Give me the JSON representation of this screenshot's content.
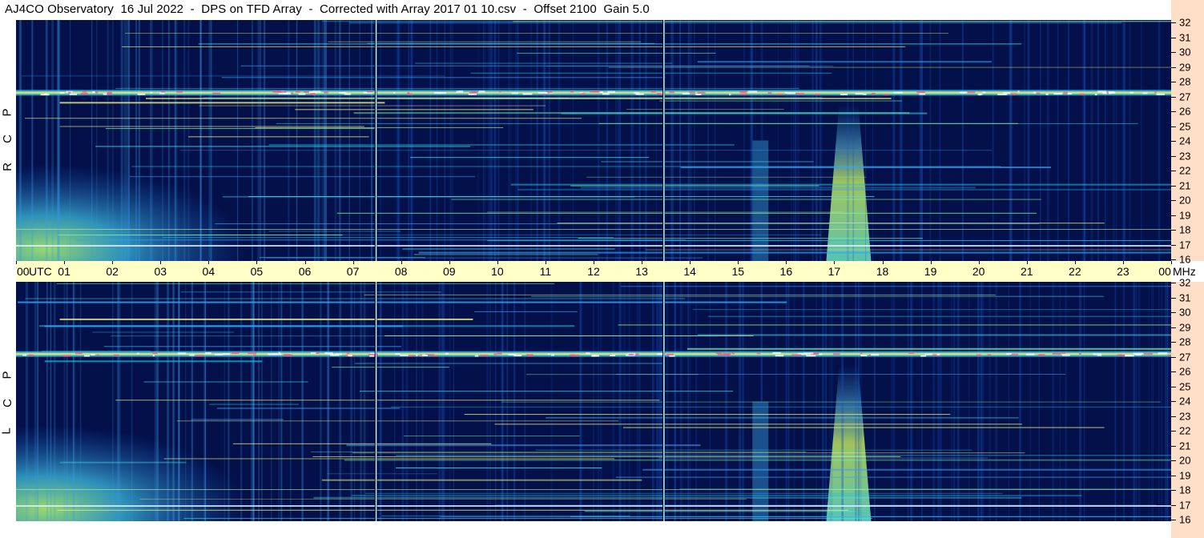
{
  "title": "AJ4CO Observatory  16 Jul 2022  -  DPS on TFD Array  -  Corrected with Array 2017 01 10.csv  -  Offset 2100  Gain 5.0",
  "panels": [
    {
      "id": "top",
      "polarization": [
        "R",
        "C",
        "P"
      ]
    },
    {
      "id": "bottom",
      "polarization": [
        "L",
        "C",
        "P"
      ]
    }
  ],
  "time_axis": {
    "labels": [
      "00",
      "01",
      "02",
      "03",
      "04",
      "05",
      "06",
      "07",
      "08",
      "09",
      "10",
      "11",
      "12",
      "13",
      "14",
      "15",
      "16",
      "17",
      "18",
      "19",
      "20",
      "21",
      "22",
      "23",
      "00"
    ],
    "utc_label": "UTC",
    "unit_label": "MHz"
  },
  "freq_axis": {
    "labels": [
      "32",
      "31",
      "30",
      "29",
      "28",
      "27",
      "26",
      "25",
      "24",
      "23",
      "22",
      "21",
      "20",
      "19",
      "18",
      "17",
      "16"
    ]
  },
  "colors": {
    "background_dark": "#03104a",
    "time_axis_bg": "#ffffc8",
    "freq_axis_bg": "#ffdfc8",
    "marker_line": "#c8f0ff"
  },
  "chart_data": {
    "type": "heatmap",
    "title": "AJ4CO Observatory  16 Jul 2022  -  DPS on TFD Array  -  Corrected with Array 2017 01 10.csv  -  Offset 2100  Gain 5.0",
    "x": {
      "unit": "UTC",
      "range": [
        0,
        24
      ],
      "ticks": [
        "00",
        "01",
        "02",
        "03",
        "04",
        "05",
        "06",
        "07",
        "08",
        "09",
        "10",
        "11",
        "12",
        "13",
        "14",
        "15",
        "16",
        "17",
        "18",
        "19",
        "20",
        "21",
        "22",
        "23",
        "00"
      ]
    },
    "y": {
      "unit": "MHz",
      "range": [
        16,
        32
      ],
      "ticks": [
        32,
        31,
        30,
        29,
        28,
        27,
        26,
        25,
        24,
        23,
        22,
        21,
        20,
        19,
        18,
        17,
        16
      ]
    },
    "panels": [
      "RCP",
      "LCP"
    ],
    "features": [
      {
        "type": "band",
        "freq": 27.2,
        "note": "strong horizontal interference band"
      },
      {
        "type": "burst",
        "time_start": 17.0,
        "time_end": 17.6,
        "freq_range": [
          16,
          28
        ],
        "note": "broadband emission"
      },
      {
        "type": "marker",
        "time": 7.47
      },
      {
        "type": "marker",
        "time": 13.45
      }
    ]
  }
}
